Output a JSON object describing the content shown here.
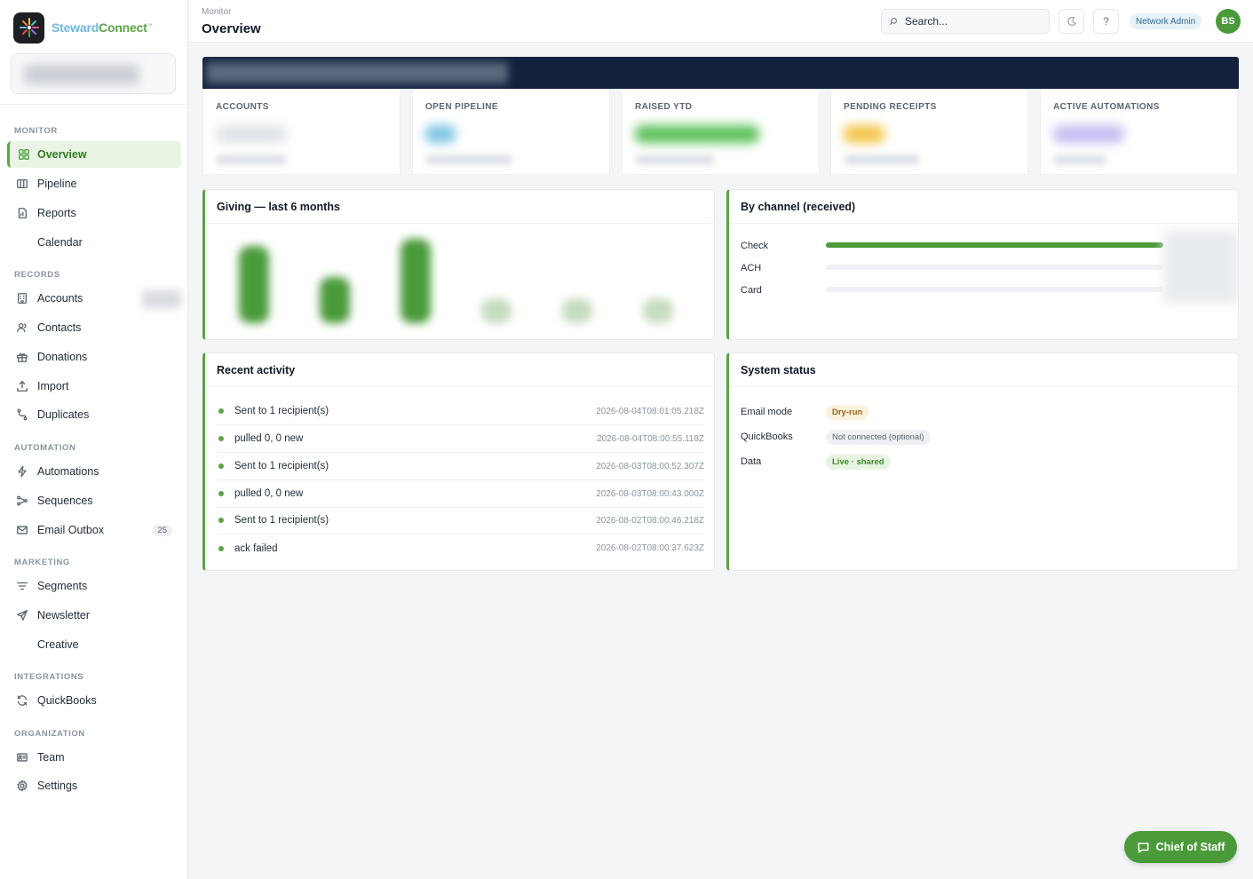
{
  "brand": {
    "name_part1": "Steward",
    "name_part2": "Connect",
    "trademark": "™"
  },
  "header": {
    "breadcrumb": "Monitor",
    "title": "Overview",
    "search_placeholder": "Search...",
    "theme_icon": "moon-icon",
    "help_label": "?",
    "role": "Network Admin",
    "avatar_initials": "BS"
  },
  "sidebar": {
    "sections": {
      "monitor": "MONITOR",
      "records": "RECORDS",
      "automation": "AUTOMATION",
      "marketing": "MARKETING",
      "integrations": "INTEGRATIONS",
      "organization": "ORGANIZATION"
    },
    "items": {
      "overview": "Overview",
      "pipeline": "Pipeline",
      "reports": "Reports",
      "calendar": "Calendar",
      "accounts": "Accounts",
      "contacts": "Contacts",
      "donations": "Donations",
      "import": "Import",
      "duplicates": "Duplicates",
      "automations": "Automations",
      "sequences": "Sequences",
      "email_outbox": "Email Outbox",
      "segments": "Segments",
      "newsletter": "Newsletter",
      "creative": "Creative",
      "quickbooks": "QuickBooks",
      "team": "Team",
      "settings": "Settings"
    },
    "email_outbox_count": "25",
    "active_item": "overview"
  },
  "kpis": [
    {
      "label": "ACCOUNTS",
      "accent": "#d6dbe1"
    },
    {
      "label": "OPEN PIPELINE",
      "accent": "#7cc4e4"
    },
    {
      "label": "RAISED YTD",
      "accent": "#5cc25a"
    },
    {
      "label": "PENDING RECEIPTS",
      "accent": "#f3c64a"
    },
    {
      "label": "ACTIVE AUTOMATIONS",
      "accent": "#b3a2ee"
    }
  ],
  "giving": {
    "title": "Giving — last 6 months",
    "bar_levels": [
      0.92,
      0.55,
      1.0,
      0.3,
      0.3,
      0.3
    ],
    "bar_color": "#4a9a3a"
  },
  "channel": {
    "title": "By channel (received)",
    "channels": [
      {
        "label": "Check",
        "fraction": 1.0
      },
      {
        "label": "ACH",
        "fraction": 0.0
      },
      {
        "label": "Card",
        "fraction": 0.0
      }
    ]
  },
  "activity": {
    "title": "Recent activity",
    "items": [
      {
        "text": "Sent to 1 recipient(s)",
        "time": "2026-08-04T08:01:05.218Z"
      },
      {
        "text": "pulled 0, 0 new",
        "time": "2026-08-04T08:00:55.118Z"
      },
      {
        "text": "Sent to 1 recipient(s)",
        "time": "2026-08-03T08:00:52.307Z"
      },
      {
        "text": "pulled 0, 0 new",
        "time": "2026-08-03T08:00:43.000Z"
      },
      {
        "text": "Sent to 1 recipient(s)",
        "time": "2026-08-02T08:00:46.218Z"
      },
      {
        "text": "ack failed",
        "time": "2026-08-02T08:00:37.623Z"
      }
    ]
  },
  "system_status": {
    "title": "System status",
    "rows": [
      {
        "label": "Email mode",
        "value": "Dry-run",
        "tone": "warn"
      },
      {
        "label": "QuickBooks",
        "value": "Not connected (optional)",
        "tone": "neutral"
      },
      {
        "label": "Data",
        "value": "Live · shared",
        "tone": "ok"
      }
    ]
  },
  "chief_of_staff": {
    "label": "Chief of Staff"
  },
  "colors": {
    "accent": "#4a9a3a",
    "banner": "#13213d",
    "info": "#2f6f9a"
  }
}
